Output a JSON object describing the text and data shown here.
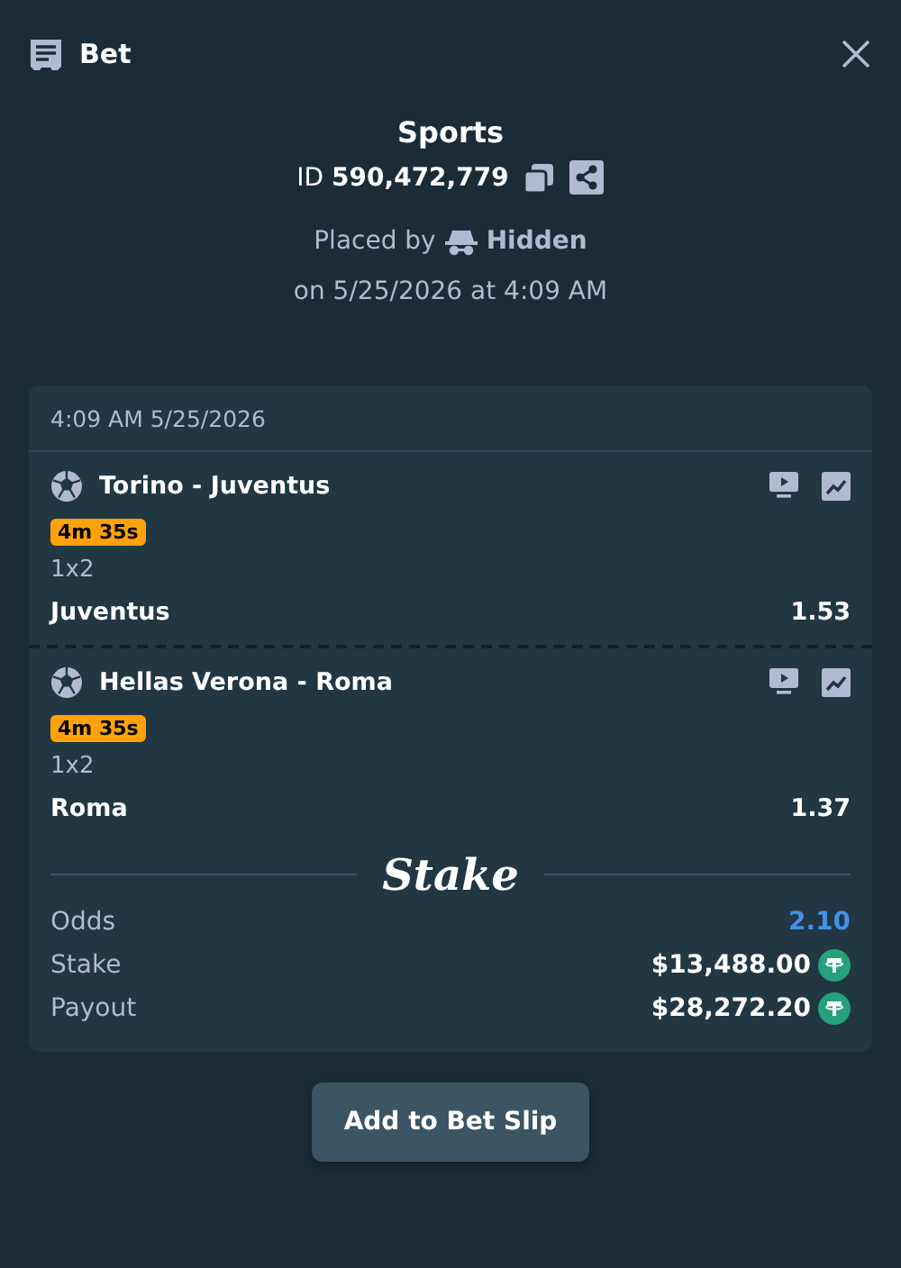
{
  "header": {
    "title": "Bet"
  },
  "summary": {
    "category": "Sports",
    "id_label": "ID",
    "id_value": "590,472,779",
    "placed_by_label": "Placed by",
    "placed_by_user": "Hidden",
    "placed_on": "on 5/25/2026 at 4:09 AM"
  },
  "card": {
    "timestamp": "4:09 AM 5/25/2026",
    "legs": [
      {
        "event": "Torino - Juventus",
        "timer": "4m 35s",
        "market": "1x2",
        "selection": "Juventus",
        "odds": "1.53"
      },
      {
        "event": "Hellas Verona - Roma",
        "timer": "4m 35s",
        "market": "1x2",
        "selection": "Roma",
        "odds": "1.37"
      }
    ],
    "logo": "Stake",
    "totals": [
      {
        "label": "Odds",
        "value": "2.10",
        "kind": "odds"
      },
      {
        "label": "Stake",
        "value": "$13,488.00",
        "kind": "currency"
      },
      {
        "label": "Payout",
        "value": "$28,272.20",
        "kind": "currency"
      }
    ]
  },
  "buttons": [
    "Add to Bet Slip"
  ]
}
